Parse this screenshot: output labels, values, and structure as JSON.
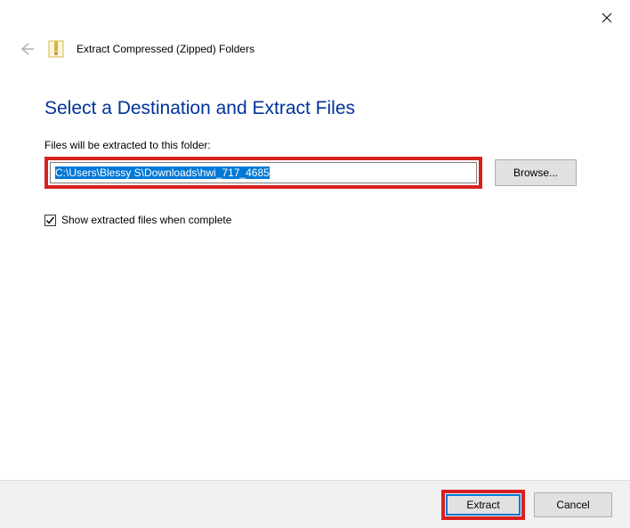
{
  "titlebar": {
    "close_tooltip": "Close"
  },
  "header": {
    "back_tooltip": "Back",
    "wizard_title": "Extract Compressed (Zipped) Folders"
  },
  "content": {
    "heading": "Select a Destination and Extract Files",
    "dest_label": "Files will be extracted to this folder:",
    "path_value": "C:\\Users\\Blessy S\\Downloads\\hwi_717_4685",
    "browse_label": "Browse...",
    "show_files_label": "Show extracted files when complete",
    "show_files_checked": true
  },
  "footer": {
    "extract_label": "Extract",
    "cancel_label": "Cancel"
  }
}
